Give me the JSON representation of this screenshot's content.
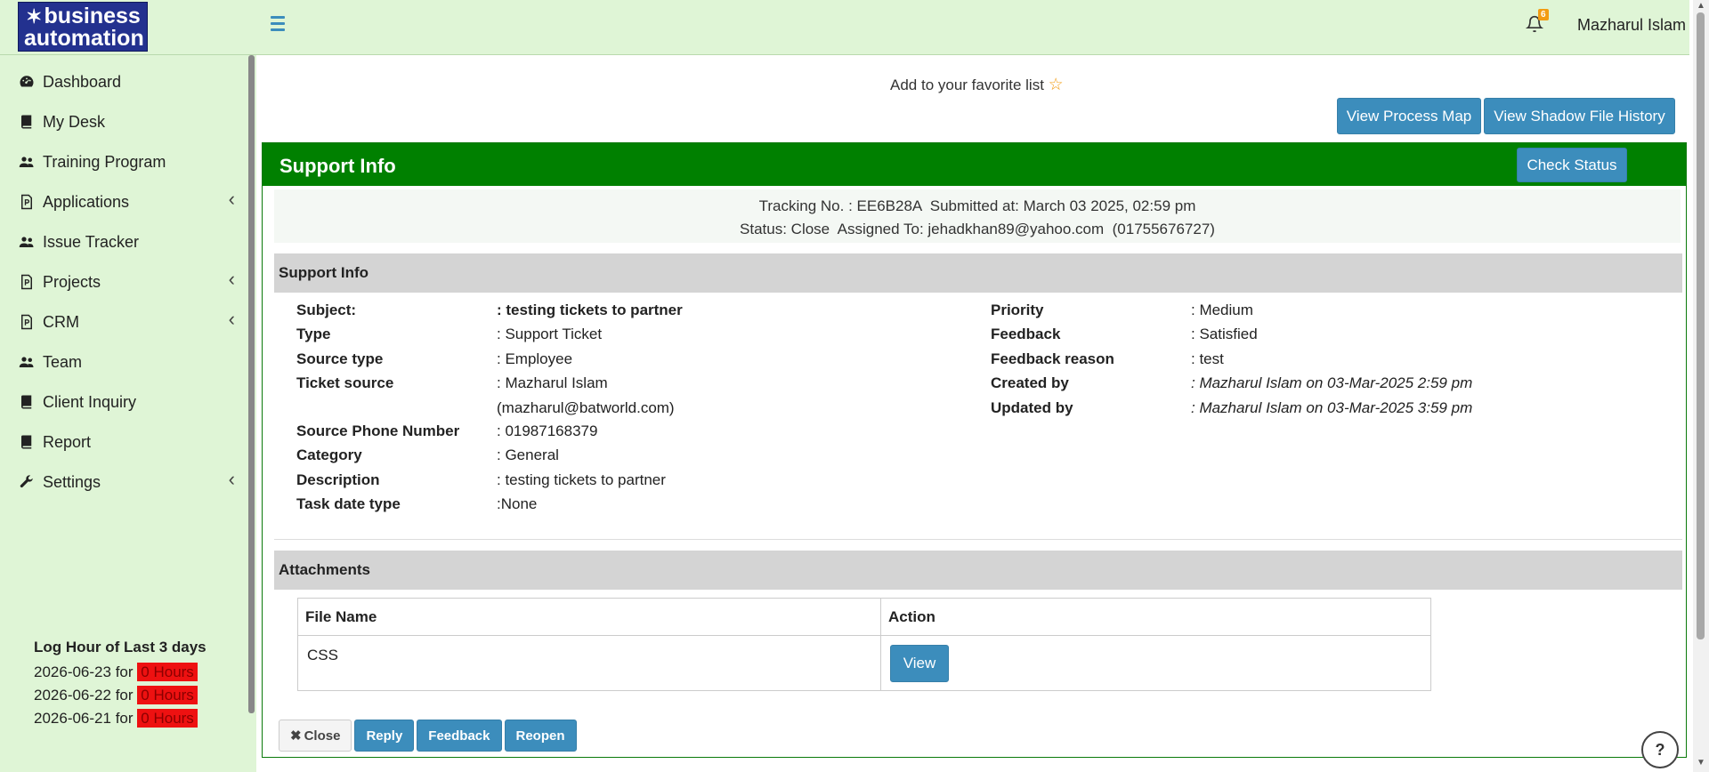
{
  "header": {
    "logo_line1": "business",
    "logo_line2": "automation",
    "notification_count": "6",
    "user_name": "Mazharul Islam"
  },
  "sidebar": {
    "items": [
      {
        "label": "Dashboard",
        "icon": "dashboard-icon",
        "has_submenu": false
      },
      {
        "label": "My Desk",
        "icon": "book-icon",
        "has_submenu": false
      },
      {
        "label": "Training Program",
        "icon": "users-icon",
        "has_submenu": false
      },
      {
        "label": "Applications",
        "icon": "file-powerpoint-icon",
        "has_submenu": true
      },
      {
        "label": "Issue Tracker",
        "icon": "users-icon",
        "has_submenu": false
      },
      {
        "label": "Projects",
        "icon": "file-powerpoint-icon",
        "has_submenu": true
      },
      {
        "label": "CRM",
        "icon": "file-powerpoint-icon",
        "has_submenu": true
      },
      {
        "label": "Team",
        "icon": "users-icon",
        "has_submenu": false
      },
      {
        "label": "Client Inquiry",
        "icon": "book-icon",
        "has_submenu": false
      },
      {
        "label": "Report",
        "icon": "book-icon",
        "has_submenu": false
      },
      {
        "label": "Settings",
        "icon": "wrench-icon",
        "has_submenu": true
      }
    ],
    "log_hours": {
      "title": "Log Hour of Last 3 days",
      "rows": [
        {
          "date": "2026-06-23",
          "for": "for",
          "hours": "0 Hours"
        },
        {
          "date": "2026-06-22",
          "for": "for",
          "hours": "0 Hours"
        },
        {
          "date": "2026-06-21",
          "for": "for",
          "hours": "0 Hours"
        }
      ]
    }
  },
  "main": {
    "favorite_text": "Add to your favorite list",
    "view_process_map": "View Process Map",
    "view_shadow_history": "View Shadow File History",
    "panel_title": "Support Info",
    "check_status": "Check Status",
    "tracking_line": "Tracking No. : EE6B28A  Submitted at: March 03 2025, 02:59 pm",
    "status_line": "Status: Close  Assigned To: jehadkhan89@yahoo.com  (01755676727)",
    "support_info_title": "Support Info",
    "left_fields": [
      {
        "key": "Subject:",
        "value": ": testing tickets to partner"
      },
      {
        "key": "Type",
        "value": ": Support Ticket"
      },
      {
        "key": "Source type",
        "value": ": Employee"
      },
      {
        "key": "Ticket source",
        "value": ": Mazharul Islam"
      },
      {
        "key": "",
        "value": "(mazharul@batworld.com)"
      },
      {
        "key": "Source Phone Number",
        "value": ": 01987168379"
      },
      {
        "key": "Category",
        "value": ": General"
      },
      {
        "key": "Description",
        "value": ": testing tickets to partner"
      },
      {
        "key": "Task date type",
        "value": ":None"
      }
    ],
    "right_fields": [
      {
        "key": "Priority",
        "value": ": Medium"
      },
      {
        "key": "Feedback",
        "value": ": Satisfied"
      },
      {
        "key": "Feedback reason",
        "value": ": test"
      },
      {
        "key": "Created by",
        "value": ": Mazharul Islam on 03-Mar-2025 2:59 pm"
      },
      {
        "key": "Updated by",
        "value": ": Mazharul Islam on 03-Mar-2025 3:59 pm"
      }
    ],
    "attachments_title": "Attachments",
    "attachments_table": {
      "headers": [
        "File Name",
        "Action"
      ],
      "rows": [
        {
          "file_name": "CSS",
          "action": "View"
        }
      ]
    },
    "actions": {
      "close": "Close",
      "reply": "Reply",
      "feedback": "Feedback",
      "reopen": "Reopen"
    },
    "help": "?"
  },
  "colors": {
    "topbar_bg": "#dff5d6",
    "panel_header": "#008000",
    "primary_button": "#3c8dbc",
    "hours_badge": "#ee1111"
  }
}
